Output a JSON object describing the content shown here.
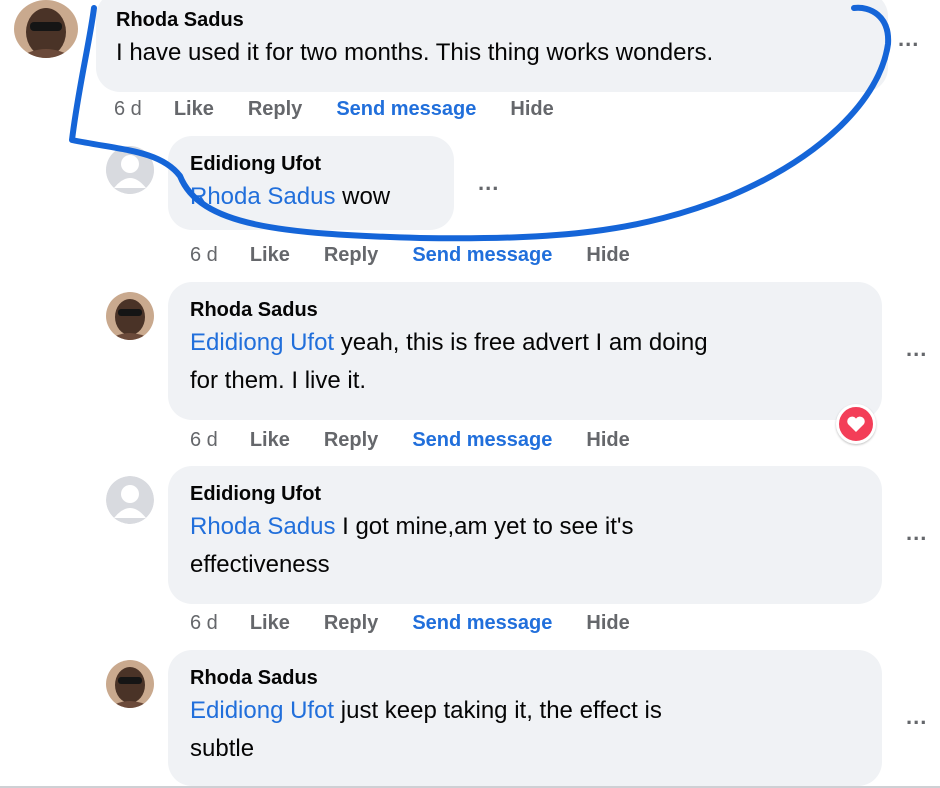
{
  "comments": [
    {
      "author": "Rhoda Sadus",
      "mention": "",
      "text": "I have used it for two months. This thing works wonders.",
      "text_line2": "",
      "time": "6 d",
      "like": "Like",
      "reply": "Reply",
      "send": "Send message",
      "hide": "Hide",
      "more": "..."
    },
    {
      "author": "Edidiong Ufot",
      "mention": "Rhoda Sadus",
      "text": " wow",
      "text_line2": "",
      "time": "6 d",
      "like": "Like",
      "reply": "Reply",
      "send": "Send message",
      "hide": "Hide",
      "more": "..."
    },
    {
      "author": "Rhoda Sadus",
      "mention": "Edidiong Ufot",
      "text": " yeah, this is free advert I am doing",
      "text_line2": "for them. I live it.",
      "time": "6 d",
      "like": "Like",
      "reply": "Reply",
      "send": "Send message",
      "hide": "Hide",
      "more": "...",
      "reaction": "heart"
    },
    {
      "author": "Edidiong Ufot",
      "mention": "Rhoda Sadus",
      "text": " I got mine,am yet to see it's",
      "text_line2": "effectiveness",
      "time": "6 d",
      "like": "Like",
      "reply": "Reply",
      "send": "Send message",
      "hide": "Hide",
      "more": "..."
    },
    {
      "author": "Rhoda Sadus",
      "mention": "Edidiong Ufot",
      "text": " just keep taking it, the effect is",
      "text_line2": "subtle",
      "time": "",
      "like": "",
      "reply": "",
      "send": "",
      "hide": "",
      "more": "..."
    }
  ],
  "colors": {
    "bubble": "#f0f2f5",
    "mention": "#216fdb",
    "meta": "#65676b",
    "annotation": "#1565d8",
    "heart": "#f33e58"
  }
}
